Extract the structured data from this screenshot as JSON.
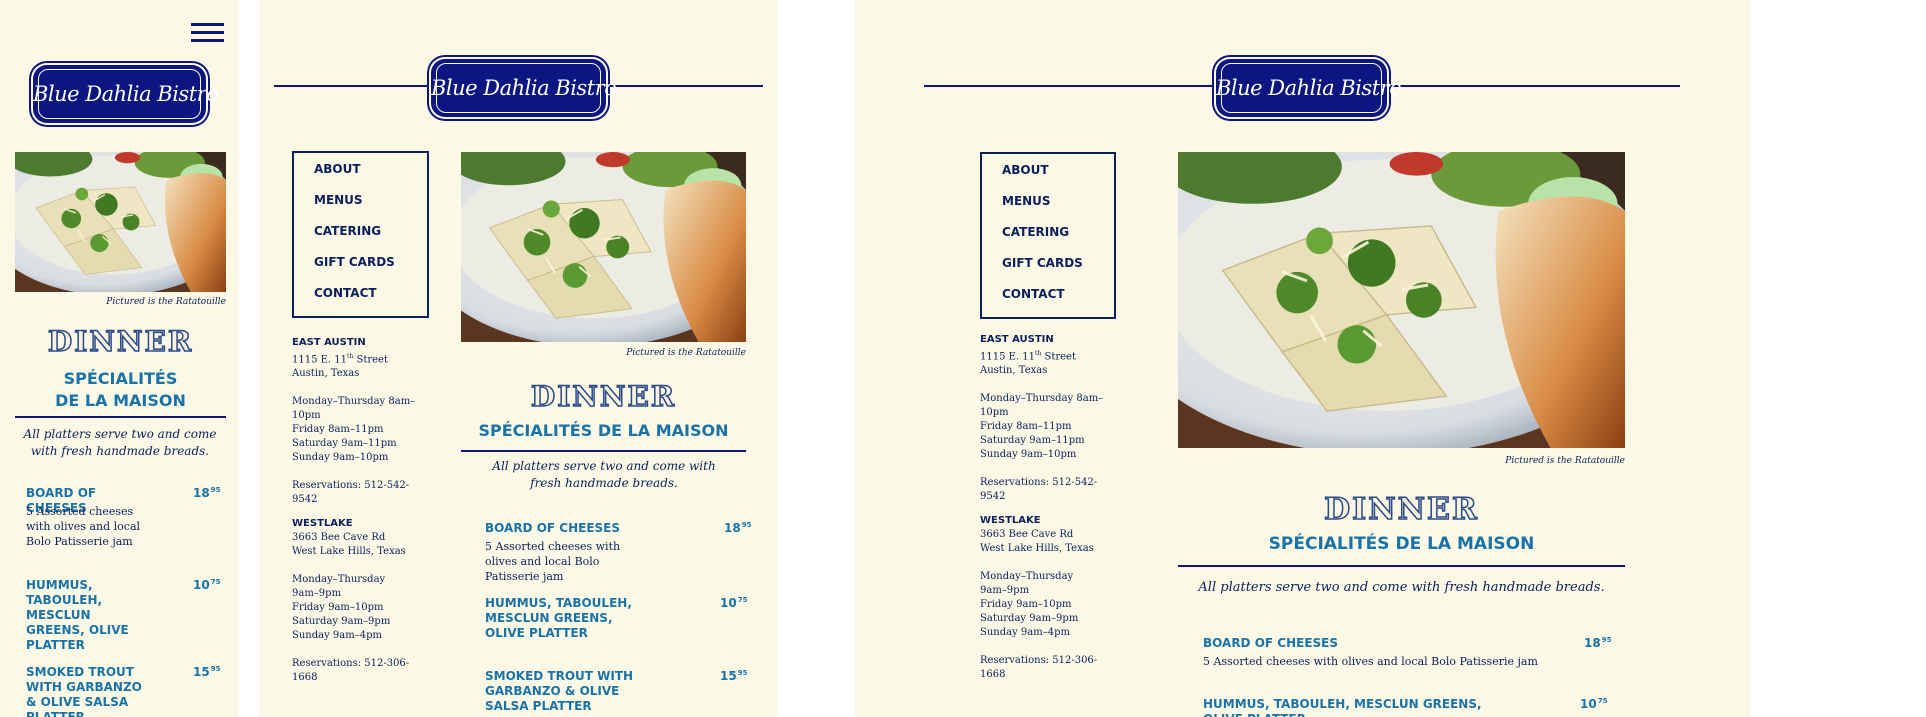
{
  "brand": {
    "name": "Blue Dahlia Bistro"
  },
  "nav": [
    {
      "label": "ABOUT"
    },
    {
      "label": "MENUS"
    },
    {
      "label": "CATERING"
    },
    {
      "label": "GIFT CARDS"
    },
    {
      "label": "CONTACT"
    }
  ],
  "caption": "Pictured is the Ratatouille",
  "menu": {
    "heading": "DINNER",
    "subheading": "SPÉCIALITÉS DE LA MAISON",
    "subheading_line1": "SPÉCIALITÉS",
    "subheading_line2": "DE LA MAISON",
    "note": "All platters serve two and come with fresh handmade breads.",
    "items": [
      {
        "name": "BOARD OF CHEESES",
        "desc": "5 Assorted cheeses with olives and local Bolo Patisserie jam",
        "price_main": "18",
        "price_cents": "95"
      },
      {
        "name": "HUMMUS, TABOULEH, MESCLUN GREENS, OLIVE PLATTER",
        "desc": "",
        "price_main": "10",
        "price_cents": "75"
      },
      {
        "name": "SMOKED TROUT WITH GARBANZO & OLIVE SALSA PLATTER",
        "desc": "",
        "price_main": "15",
        "price_cents": "95"
      }
    ]
  },
  "locations": [
    {
      "name": "EAST AUSTIN",
      "street_pre": "1115 E. 11",
      "street_sup": "th",
      "street_post": " Street",
      "city": "Austin, Texas",
      "hours": [
        "Monday–Thursday 8am–10pm",
        "Friday 8am–11pm",
        "Saturday 9am–11pm",
        "Sunday 9am–10pm"
      ],
      "reservations": "Reservations: 512-542-9542"
    },
    {
      "name": "WESTLAKE",
      "street": "3663 Bee Cave Rd",
      "city": "West Lake Hills, Texas",
      "hours": [
        "Monday–Thursday",
        "9am–9pm",
        "Friday 9am–10pm",
        "Saturday 9am–9pm",
        "Sunday 9am–4pm"
      ],
      "reservations": "Reservations: 512-306-1668"
    }
  ],
  "colors": {
    "panel_bg": "#fbf9e6",
    "navy": "#0b1680",
    "accent_blue": "#1a73a8",
    "text": "#0b1f5c"
  },
  "icons": [
    "hamburger-menu-icon"
  ]
}
